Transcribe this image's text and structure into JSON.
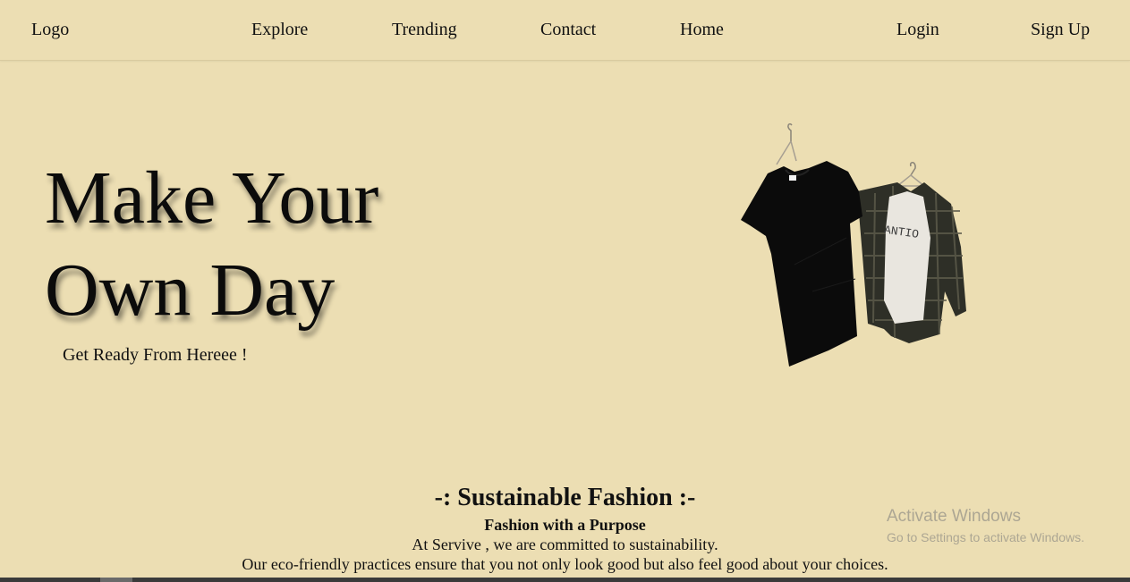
{
  "nav": {
    "logo": "Logo",
    "links": [
      "Explore",
      "Trending",
      "Contact",
      "Home"
    ],
    "login": "Login",
    "signup": "Sign Up"
  },
  "hero": {
    "title_line1": "Make Your",
    "title_line2": "Own Day",
    "subtitle": "Get Ready From Hereee !",
    "image_icon": "hanging-clothes-image",
    "shirt_print_text": "ANTIO"
  },
  "section": {
    "title": "-: Sustainable Fashion :-",
    "subtitle": "Fashion with a Purpose",
    "line1": "At Servive , we are committed to sustainability.",
    "line2": "Our eco-friendly practices ensure that you not only look good but also feel good about your choices."
  },
  "watermark": {
    "title": "Activate Windows",
    "subtitle": "Go to Settings to activate Windows."
  },
  "colors": {
    "background": "#ecdeb3",
    "text": "#111111"
  }
}
